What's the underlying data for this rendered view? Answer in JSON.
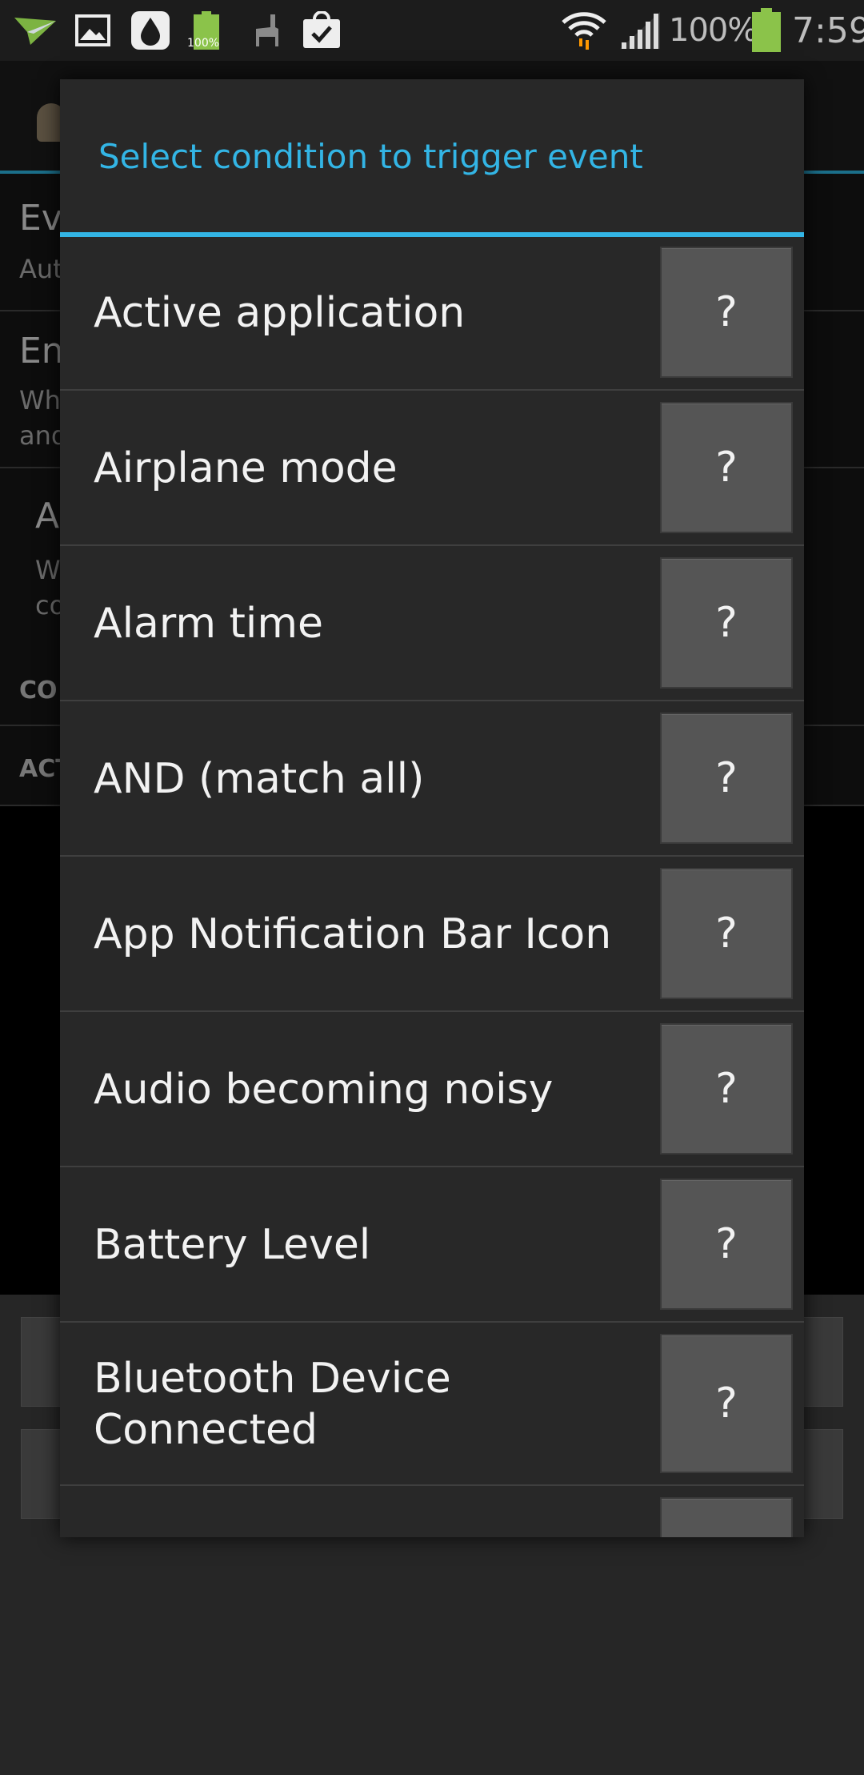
{
  "status_bar": {
    "icons": [
      "send-icon",
      "image-icon",
      "drop-icon",
      "battery-full-small-icon",
      "llama-icon",
      "shopping-bag-icon"
    ],
    "battery_badge": "100%",
    "battery_percent": "100%",
    "time": "7:59",
    "colors": {
      "battery": "#8bc34a",
      "wifi_arrow": "#ff9800"
    }
  },
  "background": {
    "rows": [
      {
        "title": "Ev",
        "subtitle": "Aut"
      },
      {
        "title": "En",
        "subtitle": "Wh",
        "subtitle2": "and"
      },
      {
        "title": "A",
        "subtitle": "W",
        "subtitle2": "co"
      }
    ],
    "section_conditions": "CO",
    "section_actions": "ACT"
  },
  "dialog": {
    "title": "Select condition to trigger event",
    "accent_color": "#33b5e5",
    "items": [
      {
        "label": "Active application",
        "help": "?"
      },
      {
        "label": "Airplane mode",
        "help": "?"
      },
      {
        "label": "Alarm time",
        "help": "?"
      },
      {
        "label": "AND (match all)",
        "help": "?"
      },
      {
        "label": "App Notification Bar Icon",
        "help": "?"
      },
      {
        "label": "Audio becoming noisy",
        "help": "?"
      },
      {
        "label": "Battery Level",
        "help": "?"
      },
      {
        "label": "Bluetooth Device Connected",
        "help": "?"
      }
    ]
  }
}
